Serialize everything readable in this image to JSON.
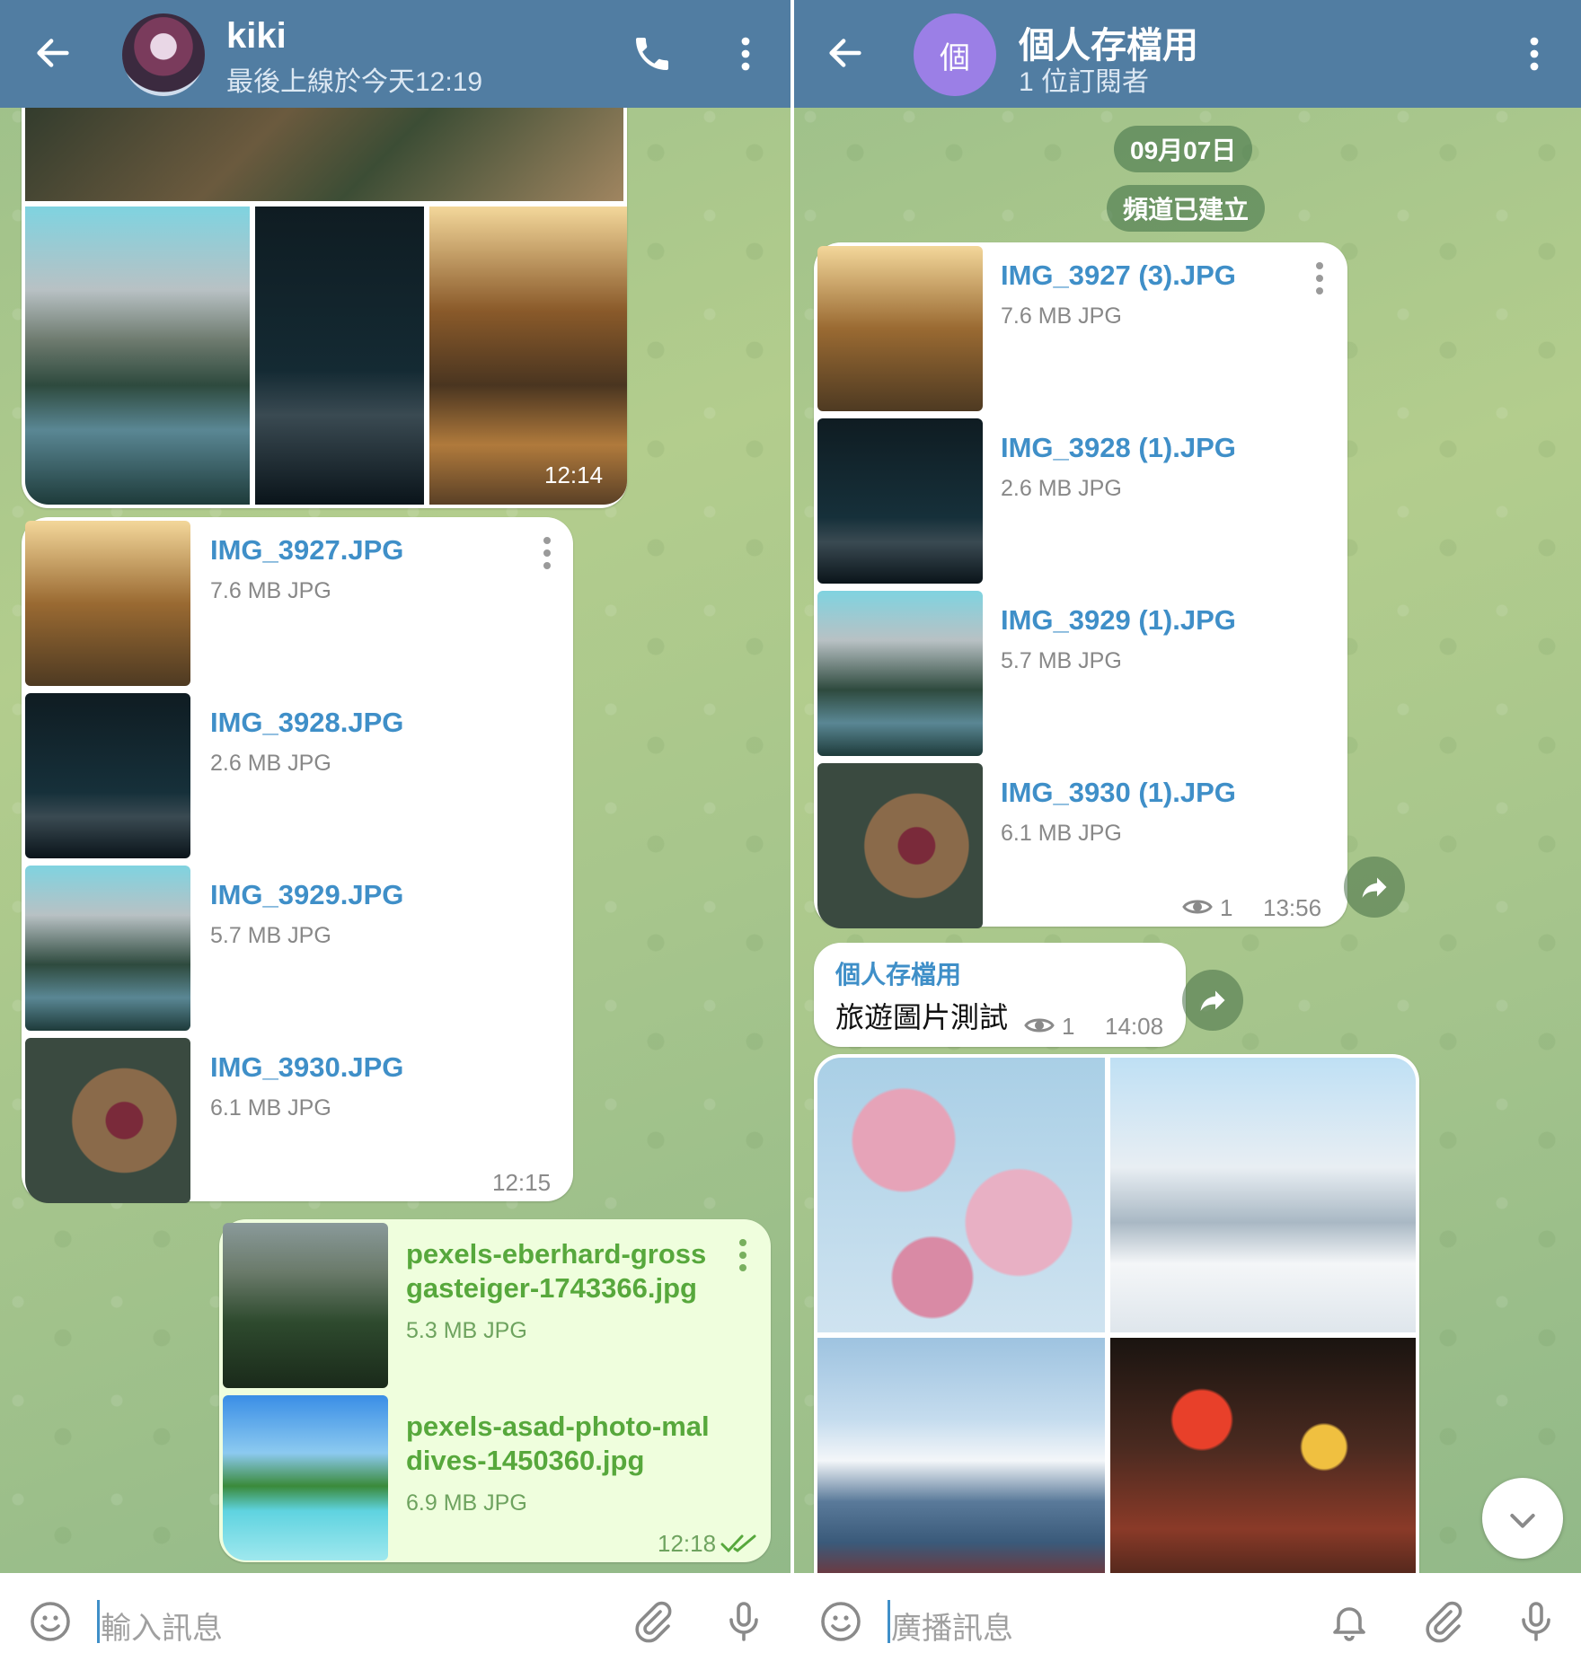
{
  "left_chat": {
    "header": {
      "name": "kiki",
      "status": "最後上線於今天12:19"
    },
    "album1": {
      "time": "12:14"
    },
    "file_group": {
      "files": [
        {
          "name": "IMG_3927.JPG",
          "size": "7.6 MB JPG"
        },
        {
          "name": "IMG_3928.JPG",
          "size": "2.6 MB JPG"
        },
        {
          "name": "IMG_3929.JPG",
          "size": "5.7 MB JPG"
        },
        {
          "name": "IMG_3930.JPG",
          "size": "6.1 MB JPG"
        }
      ],
      "time": "12:15"
    },
    "outgoing_files": {
      "files": [
        {
          "name_line1": "pexels-eberhard-gross",
          "name_line2": "gasteiger-1743366.jpg",
          "size": "5.3 MB JPG"
        },
        {
          "name_line1": "pexels-asad-photo-mal",
          "name_line2": "dives-1450360.jpg",
          "size": "6.9 MB JPG"
        }
      ],
      "time": "12:18"
    },
    "input": {
      "placeholder": "輸入訊息"
    }
  },
  "right_chat": {
    "header": {
      "avatar_letter": "個",
      "name": "個人存檔用",
      "subtitle": "1 位訂閱者"
    },
    "date_pill": "09月07日",
    "service_pill": "頻道已建立",
    "file_group": {
      "files": [
        {
          "name": "IMG_3927 (3).JPG",
          "size": "7.6 MB JPG"
        },
        {
          "name": "IMG_3928 (1).JPG",
          "size": "2.6 MB JPG"
        },
        {
          "name": "IMG_3929 (1).JPG",
          "size": "5.7 MB JPG"
        },
        {
          "name": "IMG_3930 (1).JPG",
          "size": "6.1 MB JPG"
        }
      ],
      "views": "1",
      "time": "13:56"
    },
    "text_message": {
      "channel": "個人存檔用",
      "text": "旅遊圖片測試",
      "views": "1",
      "time": "14:08"
    },
    "input": {
      "placeholder": "廣播訊息"
    }
  },
  "colors": {
    "header": "#517da2",
    "link": "#3f8fc8",
    "outgoing_bubble": "#effedd",
    "outgoing_text": "#57a83c"
  }
}
